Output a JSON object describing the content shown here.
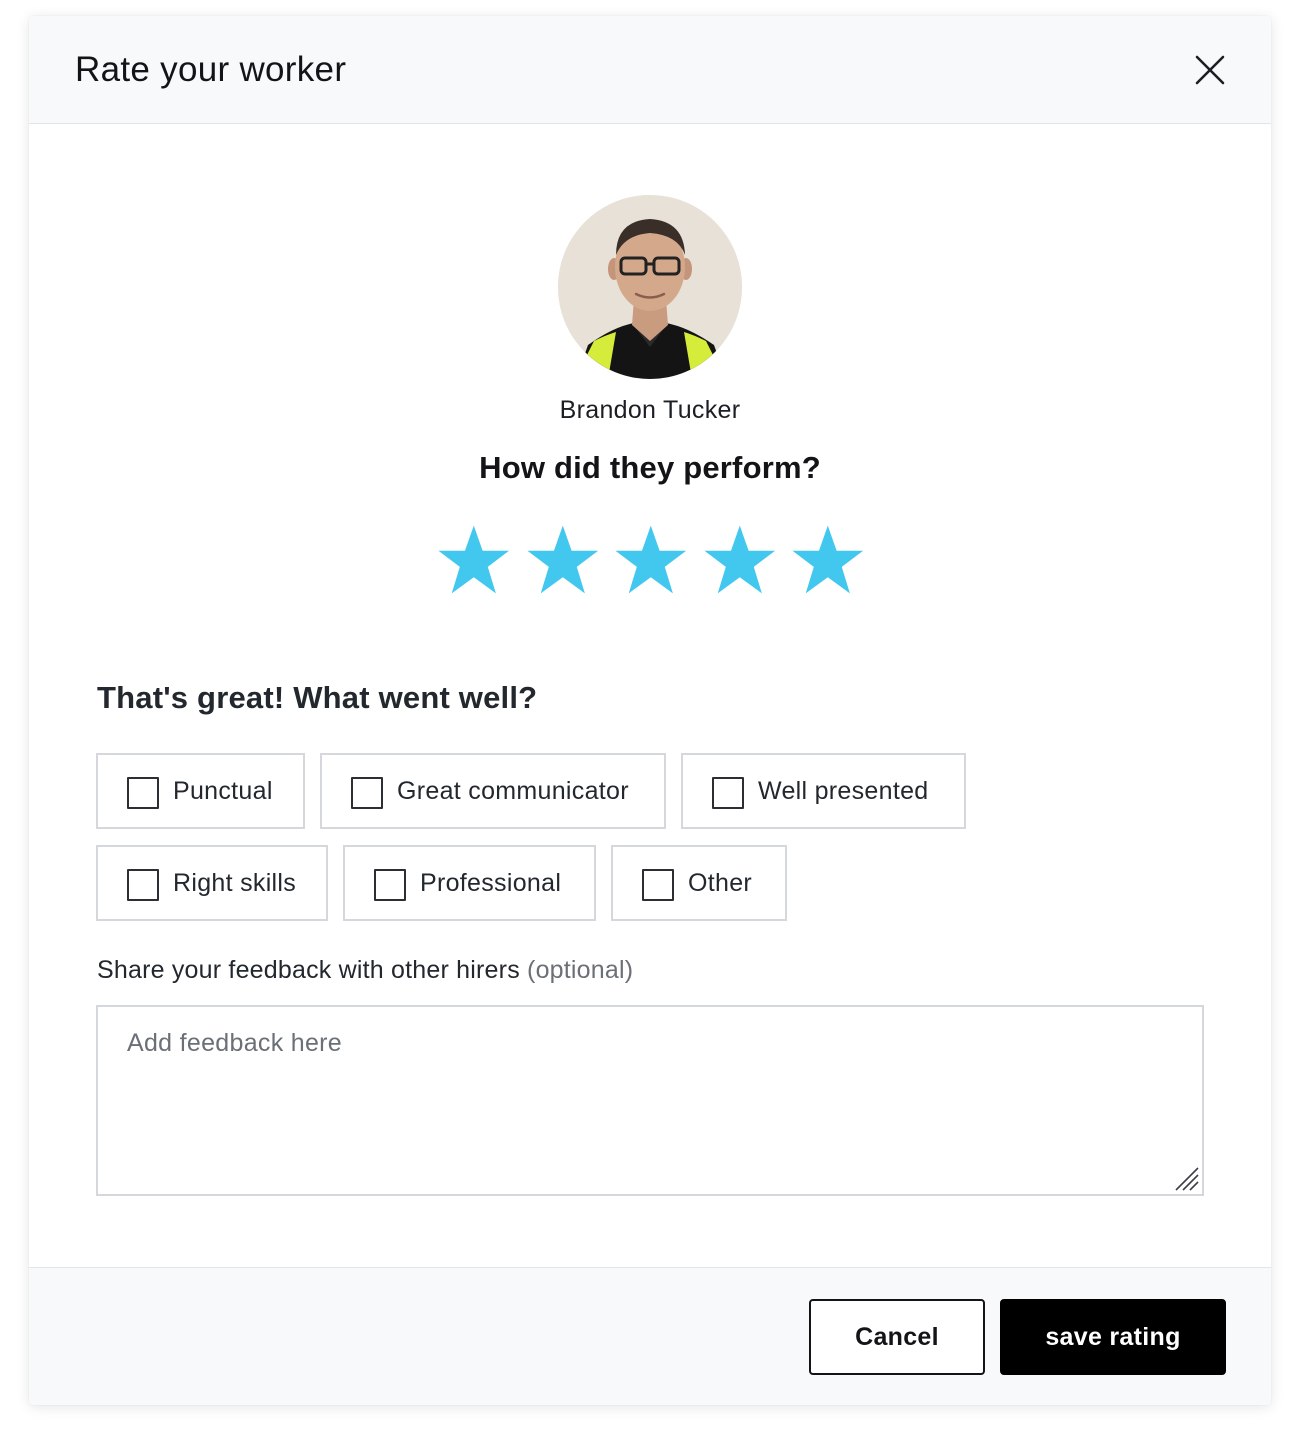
{
  "modal": {
    "title": "Rate your worker",
    "close_icon": "close-icon"
  },
  "worker": {
    "name": "Brandon Tucker",
    "avatar_icon": "worker-avatar-photo"
  },
  "rating": {
    "question": "How did they perform?",
    "value": 5,
    "max": 5,
    "star_color": "#42c8ef",
    "star_icon": "star-icon"
  },
  "went_well": {
    "heading": "That's great! What went well?",
    "options": [
      {
        "label": "Punctual",
        "checked": false
      },
      {
        "label": "Great communicator",
        "checked": false
      },
      {
        "label": "Well presented",
        "checked": false
      },
      {
        "label": "Right skills",
        "checked": false
      },
      {
        "label": "Professional",
        "checked": false
      },
      {
        "label": "Other",
        "checked": false
      }
    ]
  },
  "feedback": {
    "label": "Share your feedback with other hirers",
    "optional_note": "(optional)",
    "placeholder": "Add feedback here",
    "value": ""
  },
  "footer": {
    "cancel_label": "Cancel",
    "save_label": "save rating"
  }
}
